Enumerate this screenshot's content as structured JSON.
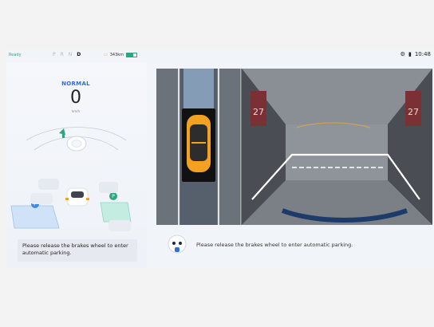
{
  "status": {
    "ready": "Ready",
    "gears": [
      "P",
      "R",
      "N",
      "D"
    ],
    "active_gear": "D",
    "range": "343km",
    "battery_level": 0.7,
    "time": "10:48"
  },
  "cluster": {
    "mode": "NORMAL",
    "speed": "0",
    "unit": "km/h"
  },
  "parking": {
    "left_message": "Please release the brakes wheel to enter automatic parking.",
    "bottom_message": "Please release the brakes wheel to enter automatic parking.",
    "bay_number_left": "27",
    "bay_number_right": "27",
    "parking_marker": "P"
  },
  "icons": {
    "gear_area": "gear-selector",
    "battery": "battery-icon",
    "settings": "settings-icon",
    "signal": "signal-icon",
    "robot": "assistant-robot-icon"
  },
  "colors": {
    "ready": "#2ea67d",
    "mode": "#2d6fd6",
    "car_accent": "#f2a122",
    "parking_lines": "#ffffff"
  }
}
